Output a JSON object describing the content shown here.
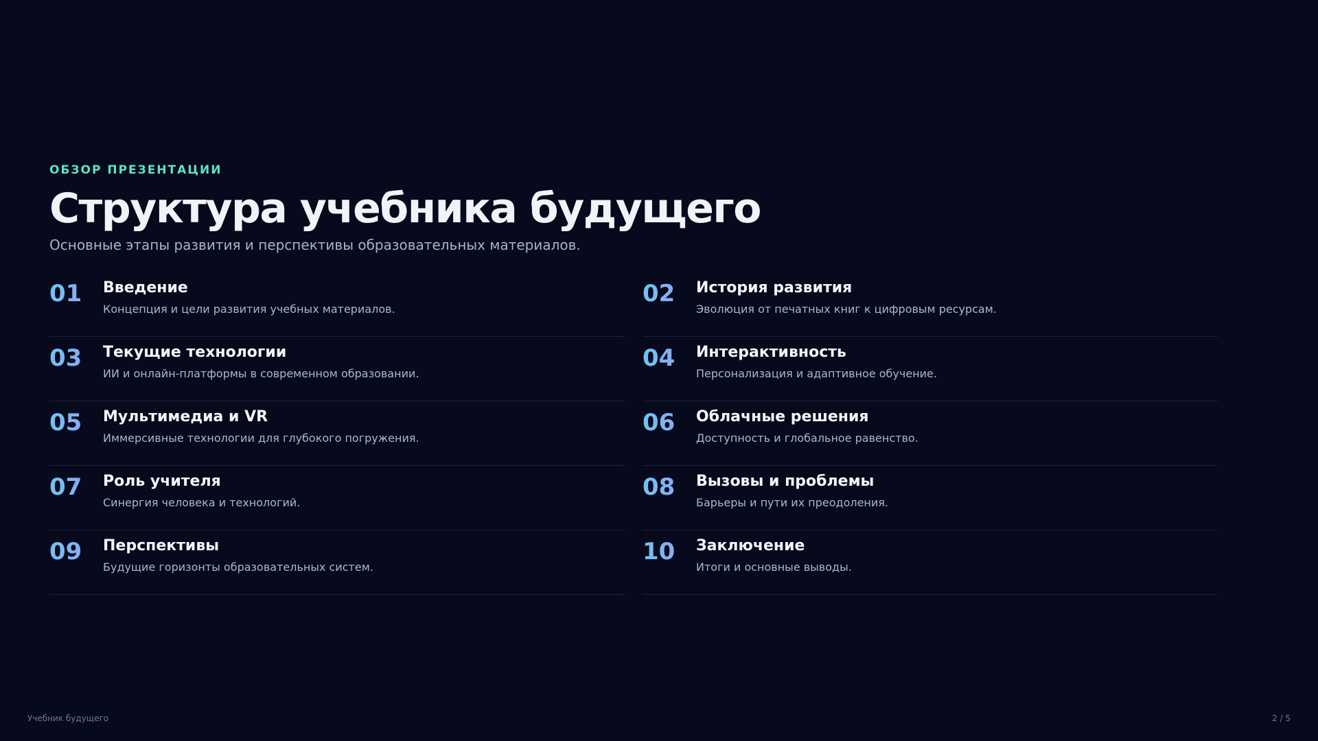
{
  "header": {
    "eyebrow": "ОБЗОР ПРЕЗЕНТАЦИИ",
    "title": "Структура учебника будущего",
    "subtitle": "Основные этапы развития и перспективы образовательных материалов."
  },
  "items": [
    {
      "num": "01",
      "title": "Введение",
      "desc": "Концепция и цели развития учебных материалов."
    },
    {
      "num": "02",
      "title": "История развития",
      "desc": "Эволюция от печатных книг к цифровым ресурсам."
    },
    {
      "num": "03",
      "title": "Текущие технологии",
      "desc": "ИИ и онлайн-платформы в современном образовании."
    },
    {
      "num": "04",
      "title": "Интерактивность",
      "desc": "Персонализация и адаптивное обучение."
    },
    {
      "num": "05",
      "title": "Мультимедиа и VR",
      "desc": "Иммерсивные технологии для глубокого погружения."
    },
    {
      "num": "06",
      "title": "Облачные решения",
      "desc": "Доступность и глобальное равенство."
    },
    {
      "num": "07",
      "title": "Роль учителя",
      "desc": "Синергия человека и технологий."
    },
    {
      "num": "08",
      "title": "Вызовы и проблемы",
      "desc": "Барьеры и пути их преодоления."
    },
    {
      "num": "09",
      "title": "Перспективы",
      "desc": "Будущие горизонты образовательных систем."
    },
    {
      "num": "10",
      "title": "Заключение",
      "desc": "Итоги и основные выводы."
    }
  ],
  "footer": {
    "deck_name": "Учебник будущего",
    "page": "2 / 5"
  },
  "colors": {
    "background": "#070a1d",
    "accent": "#5ee3c1",
    "number_gradient_start": "#6fc3f1",
    "number_gradient_end": "#9a9cf2"
  }
}
